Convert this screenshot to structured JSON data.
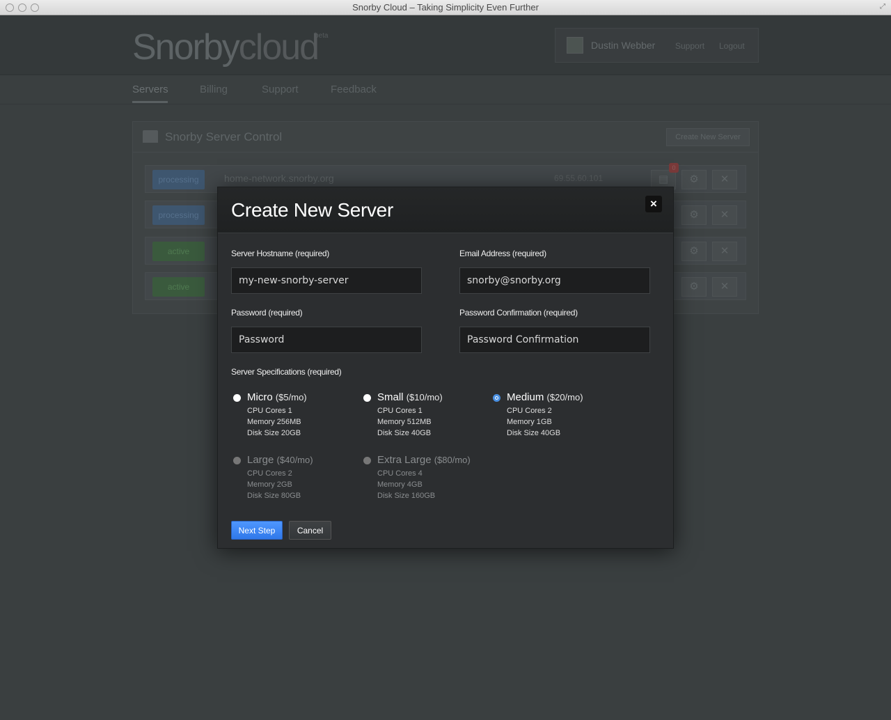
{
  "window": {
    "title": "Snorby Cloud – Taking Simplicity Even Further"
  },
  "header": {
    "logo_main": "Snorby",
    "logo_cloud": "cloud",
    "logo_badge": "beta",
    "user_name": "Dustin Webber",
    "support_link": "Support",
    "logout_link": "Logout"
  },
  "nav": {
    "items": [
      "Servers",
      "Billing",
      "Support",
      "Feedback"
    ],
    "active": "Servers"
  },
  "panel": {
    "title": "Snorby Server Control",
    "create_button": "Create New Server",
    "rows": [
      {
        "status": "processing",
        "host": "home-network.snorby.org",
        "ip": "69.55.60.101",
        "count": "0"
      },
      {
        "status": "processing",
        "host": "",
        "ip": "",
        "count": ""
      },
      {
        "status": "active",
        "host": "",
        "ip": "",
        "count": ""
      },
      {
        "status": "active",
        "host": "",
        "ip": "",
        "count": ""
      }
    ]
  },
  "modal": {
    "title": "Create New Server",
    "close_icon": "×",
    "hostname_label": "Server Hostname (required)",
    "hostname_value": "my-new-snorby-server",
    "email_label": "Email Address (required)",
    "email_value": "snorby@snorby.org",
    "password_label": "Password (required)",
    "password_placeholder": "Password",
    "password_confirm_label": "Password Confirmation (required)",
    "password_confirm_placeholder": "Password Confirmation",
    "specs_label": "Server Specifications (required)",
    "plans": [
      {
        "name": "Micro",
        "price": "($5/mo)",
        "cpu": "CPU Cores 1",
        "memory": "Memory 256MB",
        "disk": "Disk Size 20GB",
        "selected": false,
        "disabled": false
      },
      {
        "name": "Small",
        "price": "($10/mo)",
        "cpu": "CPU Cores 1",
        "memory": "Memory 512MB",
        "disk": "Disk Size 40GB",
        "selected": false,
        "disabled": false
      },
      {
        "name": "Medium",
        "price": "($20/mo)",
        "cpu": "CPU Cores 2",
        "memory": "Memory 1GB",
        "disk": "Disk Size 40GB",
        "selected": true,
        "disabled": false
      },
      {
        "name": "Large",
        "price": "($40/mo)",
        "cpu": "CPU Cores 2",
        "memory": "Memory 2GB",
        "disk": "Disk Size 80GB",
        "selected": false,
        "disabled": true
      },
      {
        "name": "Extra Large",
        "price": "($80/mo)",
        "cpu": "CPU Cores 4",
        "memory": "Memory 4GB",
        "disk": "Disk Size 160GB",
        "selected": false,
        "disabled": true
      }
    ],
    "next_button": "Next Step",
    "cancel_button": "Cancel"
  },
  "colors": {
    "accent": "#4a90e2",
    "processing": "#3e566f",
    "active": "#3a5a3d"
  }
}
